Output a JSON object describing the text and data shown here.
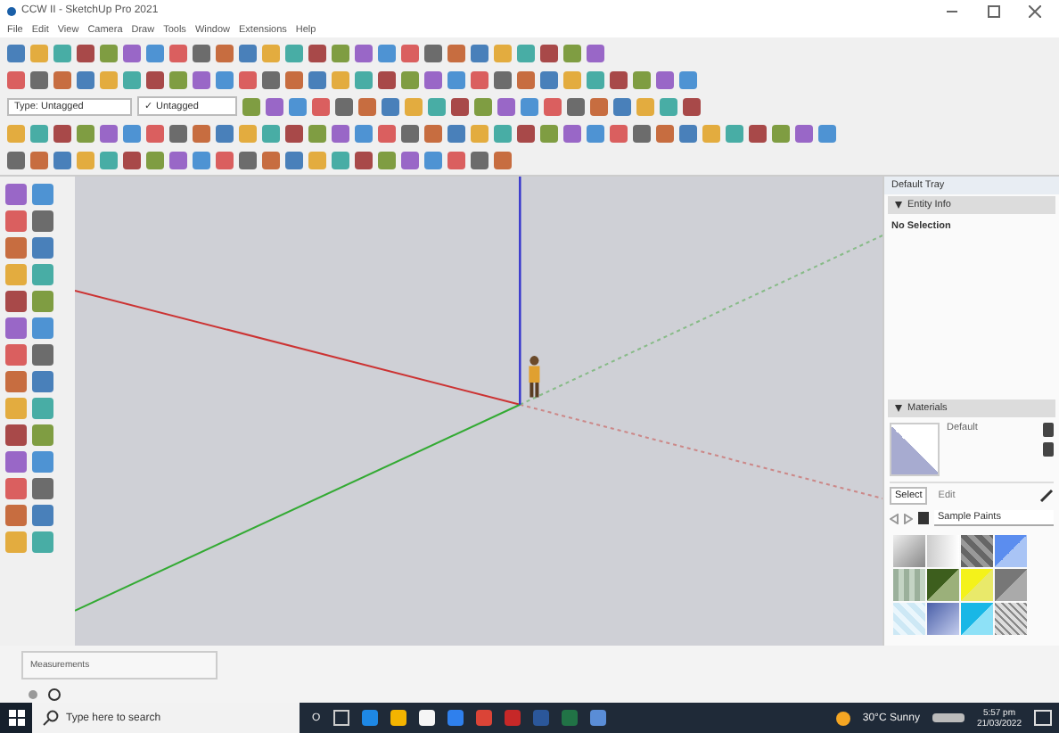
{
  "window": {
    "title": "CCW II - SketchUp Pro 2021"
  },
  "menu": [
    "File",
    "Edit",
    "View",
    "Camera",
    "Draw",
    "Tools",
    "Window",
    "Extensions",
    "Help"
  ],
  "toolbar": {
    "tag_dropdown": "Type: Untagged",
    "tag_select": "✓ Untagged"
  },
  "tray": {
    "title": "Default Tray",
    "panels": [
      {
        "title": "Entity Info",
        "expanded": true
      },
      {
        "title": "Materials",
        "expanded": true
      }
    ],
    "entity_text": "No Selection",
    "material_name": "Default",
    "tabs": [
      {
        "label": "Select",
        "selected": true
      },
      {
        "label": "Edit",
        "selected": false
      }
    ],
    "library": "Sample Paints"
  },
  "measurements": {
    "label": "Measurements"
  },
  "taskbar": {
    "search_placeholder": "Type here to search",
    "cortana": "O",
    "weather": "30°C Sunny",
    "time": "5:57 pm",
    "date": "21/03/2022"
  }
}
